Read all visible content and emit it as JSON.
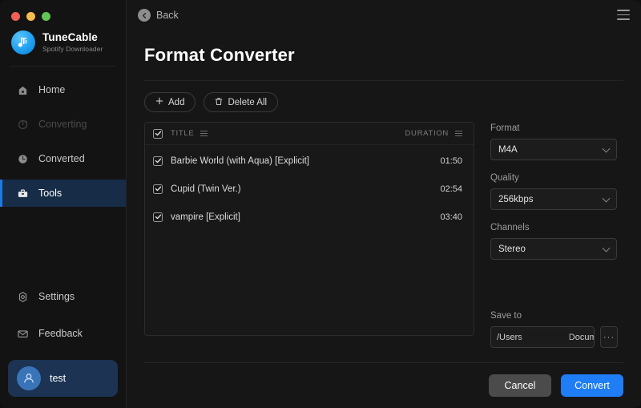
{
  "window": {
    "traffic_lights": [
      "close",
      "minimize",
      "maximize"
    ]
  },
  "brand": {
    "title": "TuneCable",
    "subtitle": "Spotify Downloader",
    "logo_icon": "music-note-icon"
  },
  "sidebar": {
    "items": [
      {
        "label": "Home",
        "icon": "home-icon",
        "state": "normal"
      },
      {
        "label": "Converting",
        "icon": "refresh-icon",
        "state": "disabled"
      },
      {
        "label": "Converted",
        "icon": "clock-icon",
        "state": "normal"
      },
      {
        "label": "Tools",
        "icon": "toolbox-icon",
        "state": "active"
      }
    ],
    "bottom_items": [
      {
        "label": "Settings",
        "icon": "gear-icon"
      },
      {
        "label": "Feedback",
        "icon": "mail-icon"
      }
    ],
    "account": {
      "name": "test",
      "icon": "user-avatar-icon"
    }
  },
  "topbar": {
    "back_label": "Back",
    "back_icon": "arrow-left-circle-icon",
    "menu_icon": "hamburger-menu-icon"
  },
  "page": {
    "title": "Format Converter"
  },
  "toolbar": {
    "add_label": "Add",
    "add_icon": "plus-icon",
    "delete_all_label": "Delete All",
    "delete_all_icon": "trash-icon"
  },
  "list": {
    "columns": [
      "TITLE",
      "DURATION"
    ],
    "select_all_checked": true,
    "rows": [
      {
        "checked": true,
        "title": "Barbie World (with Aqua) [Explicit]",
        "duration": "01:50"
      },
      {
        "checked": true,
        "title": "Cupid (Twin Ver.)",
        "duration": "02:54"
      },
      {
        "checked": true,
        "title": "vampire [Explicit]",
        "duration": "03:40"
      }
    ]
  },
  "options": {
    "format": {
      "label": "Format",
      "value": "M4A"
    },
    "quality": {
      "label": "Quality",
      "value": "256kbps"
    },
    "channels": {
      "label": "Channels",
      "value": "Stereo"
    },
    "save_to": {
      "label": "Save to",
      "prefix": "/Users",
      "suffix": "Documents/",
      "browse_label": "···"
    }
  },
  "footer": {
    "cancel_label": "Cancel",
    "convert_label": "Convert"
  },
  "colors": {
    "accent": "#1f7df5",
    "active_nav_bg": "#162c47",
    "active_nav_bar": "#1f7ae0",
    "account_bg": "#1c3354",
    "window_bg": "#161616",
    "sidebar_bg": "#131313"
  }
}
